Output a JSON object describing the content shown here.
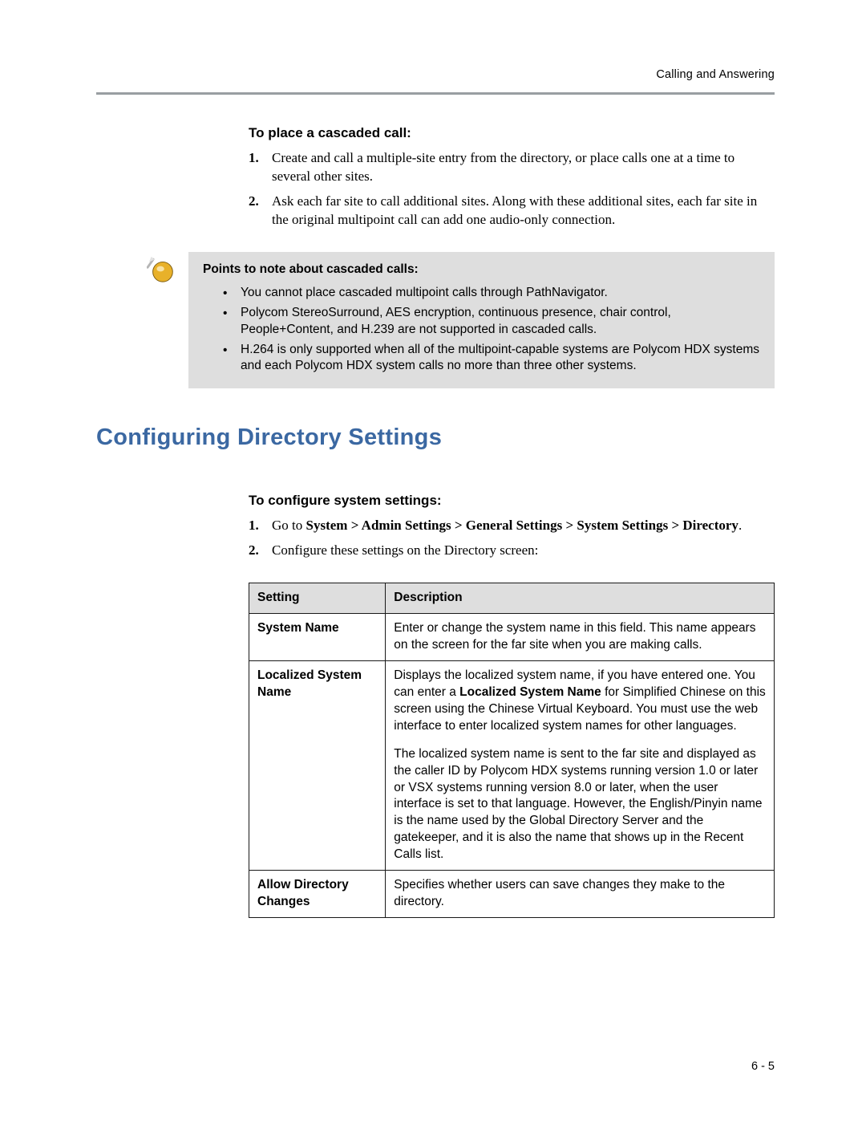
{
  "header": "Calling and Answering",
  "cascaded": {
    "heading": "To place a cascaded call:",
    "steps": [
      "Create and call a multiple-site entry from the directory, or place calls one at a time to several other sites.",
      "Ask each far site to call additional sites. Along with these additional sites, each far site in the original multipoint call can add one audio-only connection."
    ]
  },
  "note": {
    "heading": "Points to note about cascaded calls:",
    "bullets": [
      "You cannot place cascaded multipoint calls through PathNavigator.",
      "Polycom StereoSurround, AES encryption, continuous presence, chair control, People+Content, and H.239 are not supported in cascaded calls.",
      "H.264 is only supported when all of the multipoint-capable systems are Polycom HDX systems and each Polycom HDX system calls no more than three other systems."
    ]
  },
  "sectionHead": "Configuring Directory Settings",
  "configure": {
    "heading": "To configure system settings:",
    "step1_lead": "Go to ",
    "step1_path": "System > Admin Settings > General Settings > System Settings > Directory",
    "step1_tail": ".",
    "step2": "Configure these settings on the Directory screen:"
  },
  "table": {
    "head": {
      "c1": "Setting",
      "c2": "Description"
    },
    "rows": [
      {
        "setting": "System Name",
        "desc_html": "Enter or change the system name in this field. This name appears on the screen for the far site when you are making calls."
      },
      {
        "setting": "Localized System Name",
        "desc_p1a": "Displays the localized system name, if you have entered one. You can enter a ",
        "desc_p1b": "Localized System Name",
        "desc_p1c": " for Simplified Chinese on this screen using the Chinese Virtual Keyboard. You must use the web interface to enter localized system names for other languages.",
        "desc_p2": "The localized system name is sent to the far site and displayed as the caller ID by Polycom HDX systems running version 1.0 or later or VSX systems running version 8.0 or later, when the user interface is set to that language. However, the English/Pinyin name is the name used by the Global Directory Server and the gatekeeper, and it is also the name that shows up in the Recent Calls list."
      },
      {
        "setting": "Allow Directory Changes",
        "desc_html": "Specifies whether users can save changes they make to the directory."
      }
    ]
  },
  "footer": "6 - 5"
}
